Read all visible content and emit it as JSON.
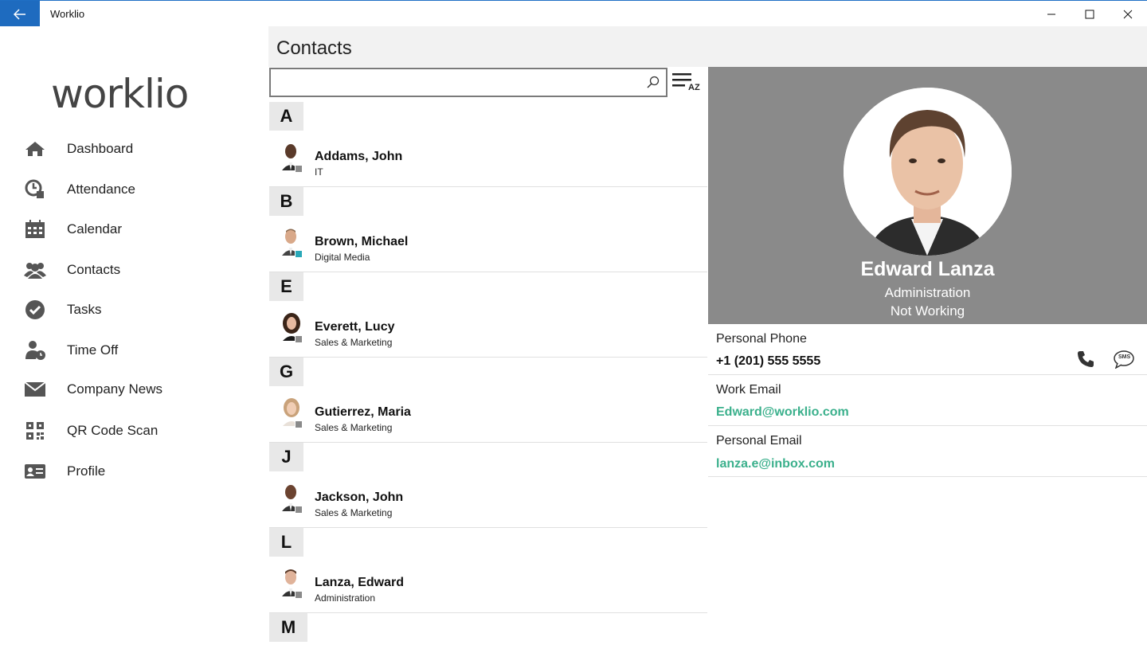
{
  "window": {
    "title": "Worklio"
  },
  "sidebar": {
    "logo_text": "worklio",
    "items": [
      {
        "label": "Dashboard",
        "icon": "home-icon"
      },
      {
        "label": "Attendance",
        "icon": "clock-icon"
      },
      {
        "label": "Calendar",
        "icon": "calendar-icon"
      },
      {
        "label": "Contacts",
        "icon": "people-icon"
      },
      {
        "label": "Tasks",
        "icon": "check-circle-icon"
      },
      {
        "label": "Time Off",
        "icon": "person-clock-icon"
      },
      {
        "label": "Company News",
        "icon": "envelope-icon"
      },
      {
        "label": "QR Code Scan",
        "icon": "qr-code-icon"
      },
      {
        "label": "Profile",
        "icon": "id-card-icon"
      }
    ]
  },
  "header": {
    "title": "Contacts"
  },
  "search": {
    "value": "",
    "placeholder": ""
  },
  "sort": {
    "label": "AZ"
  },
  "contacts": [
    {
      "letter": "A",
      "name": "Addams, John",
      "dept": "IT",
      "status": "offline"
    },
    {
      "letter": "B",
      "name": "Brown, Michael",
      "dept": "Digital Media",
      "status": "online"
    },
    {
      "letter": "E",
      "name": "Everett, Lucy",
      "dept": "Sales & Marketing",
      "status": "offline"
    },
    {
      "letter": "G",
      "name": "Gutierrez, Maria",
      "dept": "Sales & Marketing",
      "status": "offline"
    },
    {
      "letter": "J",
      "name": "Jackson, John",
      "dept": "Sales & Marketing",
      "status": "offline"
    },
    {
      "letter": "L",
      "name": "Lanza, Edward",
      "dept": "Administration",
      "status": "offline"
    },
    {
      "letter": "M",
      "name": "",
      "dept": "",
      "status": ""
    }
  ],
  "detail": {
    "name": "Edward Lanza",
    "dept": "Administration",
    "status": "Not Working",
    "personal_phone_label": "Personal Phone",
    "personal_phone": "+1 (201) 555 5555",
    "sms_label": "SMS",
    "work_email_label": "Work Email",
    "work_email": "Edward@worklio.com",
    "personal_email_label": "Personal Email",
    "personal_email": "lanza.e@inbox.com"
  },
  "colors": {
    "accent": "#1e6bbf",
    "link": "#3bb08c",
    "detail_bg": "#8a8a8a",
    "online": "#2aa8b8"
  }
}
